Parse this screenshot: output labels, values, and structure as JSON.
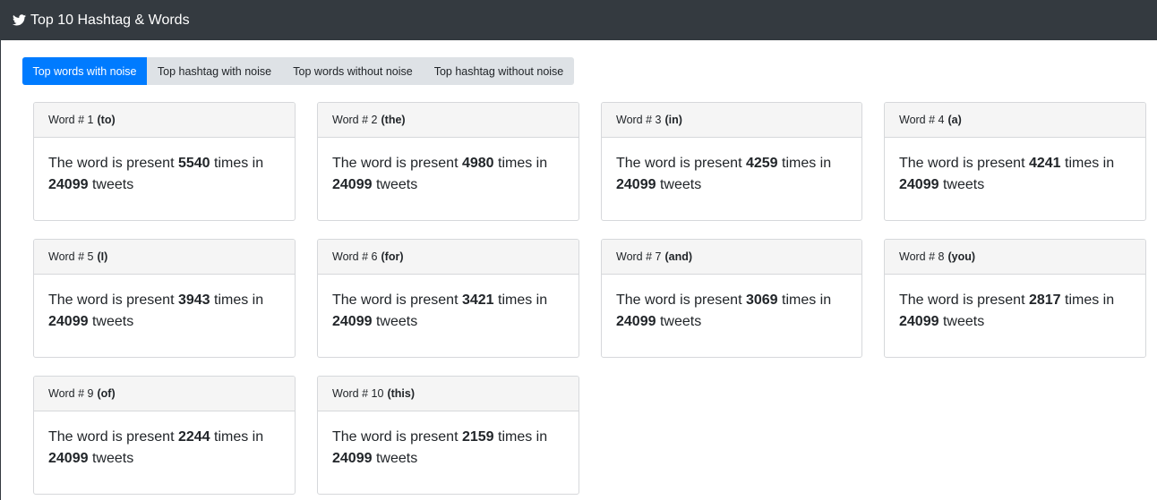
{
  "navbar": {
    "title": "Top 10 Hashtag & Words",
    "icon": "twitter-bird-icon"
  },
  "tabs": [
    {
      "label": "Top words with noise",
      "active": true
    },
    {
      "label": "Top hashtag with noise",
      "active": false
    },
    {
      "label": "Top words without noise",
      "active": false
    },
    {
      "label": "Top hashtag without noise",
      "active": false
    }
  ],
  "cards": [
    {
      "prefix": "Word # 1",
      "word": "(to)",
      "text_before": "The word is present ",
      "count": "5540",
      "text_middle": " times in",
      "total": "24099",
      "text_after": " tweets"
    },
    {
      "prefix": "Word # 2",
      "word": "(the)",
      "text_before": "The word is present ",
      "count": "4980",
      "text_middle": " times in",
      "total": "24099",
      "text_after": " tweets"
    },
    {
      "prefix": "Word # 3",
      "word": "(in)",
      "text_before": "The word is present ",
      "count": "4259",
      "text_middle": " times in",
      "total": "24099",
      "text_after": " tweets"
    },
    {
      "prefix": "Word # 4",
      "word": "(a)",
      "text_before": "The word is present ",
      "count": "4241",
      "text_middle": " times in",
      "total": "24099",
      "text_after": " tweets"
    },
    {
      "prefix": "Word # 5",
      "word": "(I)",
      "text_before": "The word is present ",
      "count": "3943",
      "text_middle": " times in",
      "total": "24099",
      "text_after": " tweets"
    },
    {
      "prefix": "Word # 6",
      "word": "(for)",
      "text_before": "The word is present ",
      "count": "3421",
      "text_middle": " times in",
      "total": "24099",
      "text_after": " tweets"
    },
    {
      "prefix": "Word # 7",
      "word": "(and)",
      "text_before": "The word is present ",
      "count": "3069",
      "text_middle": " times in",
      "total": "24099",
      "text_after": " tweets"
    },
    {
      "prefix": "Word # 8",
      "word": "(you)",
      "text_before": "The word is present ",
      "count": "2817",
      "text_middle": " times in",
      "total": "24099",
      "text_after": " tweets"
    },
    {
      "prefix": "Word # 9",
      "word": "(of)",
      "text_before": "The word is present ",
      "count": "2244",
      "text_middle": " times in",
      "total": "24099",
      "text_after": " tweets"
    },
    {
      "prefix": "Word # 10",
      "word": "(this)",
      "text_before": "The word is present ",
      "count": "2159",
      "text_middle": " times in",
      "total": "24099",
      "text_after": " tweets"
    }
  ],
  "colors": {
    "navbar": "#343a40",
    "accent": "#007bff",
    "tab_bg": "#dee2e6",
    "card_header": "#f5f5f5"
  }
}
